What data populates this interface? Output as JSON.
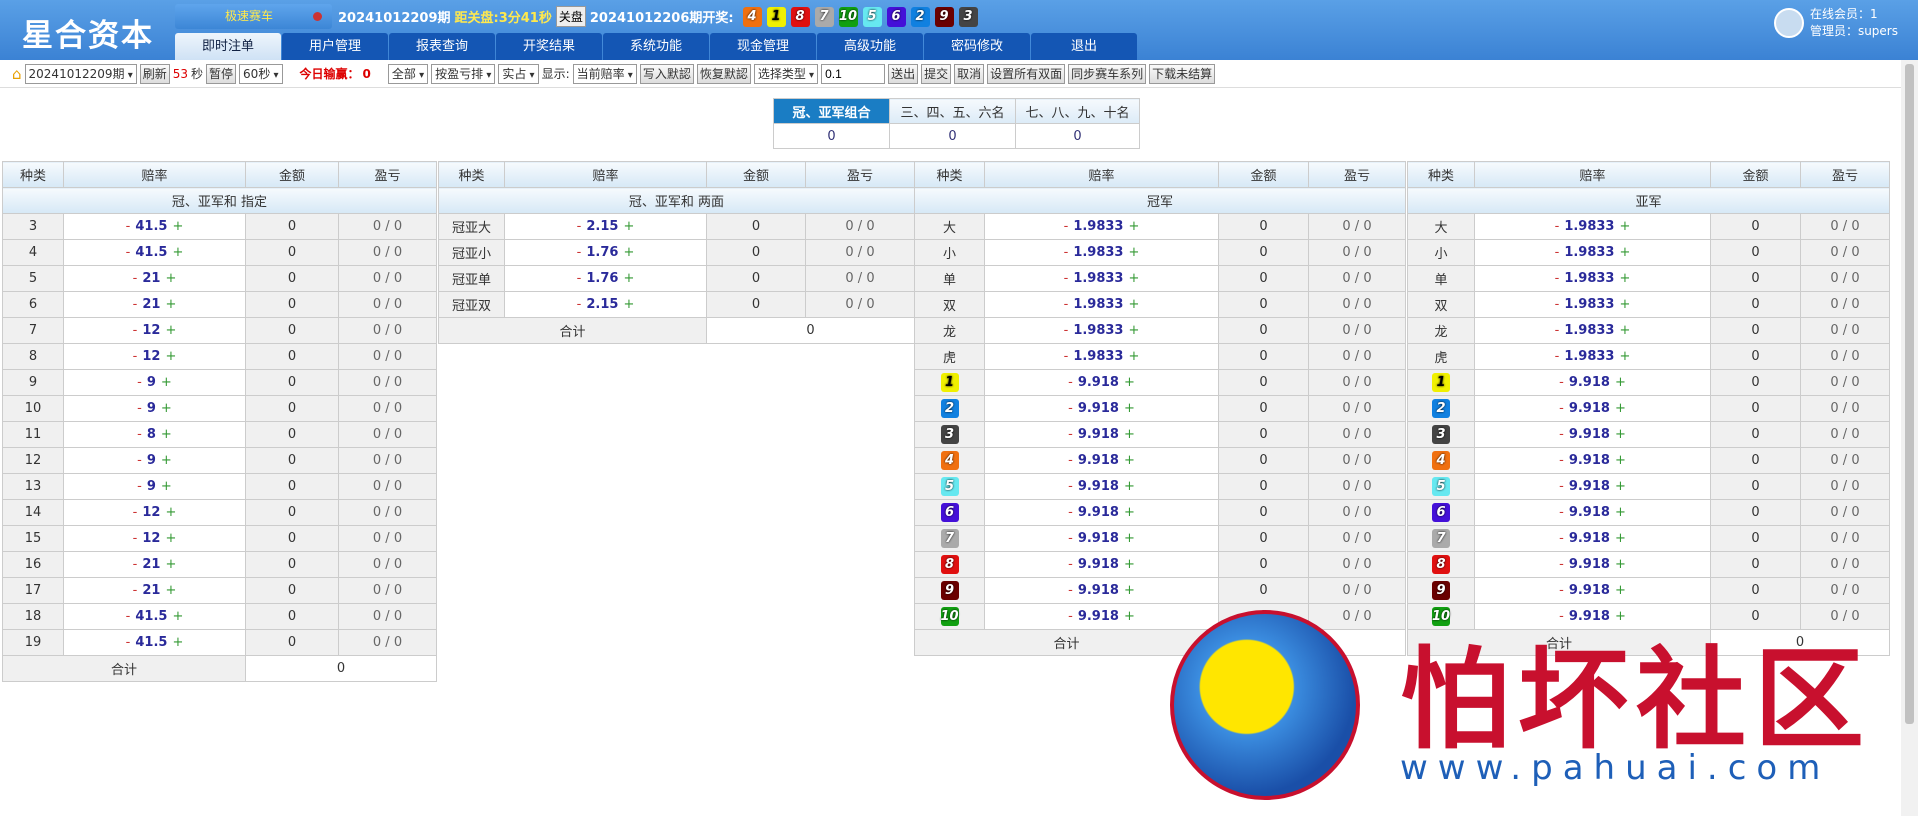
{
  "header": {
    "logo": "星合资本",
    "game": "极速赛车",
    "period": "20241012209期",
    "close_label": "距关盘:",
    "close_time": "3分41秒",
    "close_btn": "关盘",
    "last_period": "20241012206期开奖:",
    "balls": [
      {
        "n": "4",
        "c": "#f07010"
      },
      {
        "n": "1",
        "c": "#f0f000"
      },
      {
        "n": "8",
        "c": "#e01010"
      },
      {
        "n": "7",
        "c": "#aaaaaa"
      },
      {
        "n": "10",
        "c": "#11a011"
      },
      {
        "n": "5",
        "c": "#66e8f0"
      },
      {
        "n": "6",
        "c": "#4410d8"
      },
      {
        "n": "2",
        "c": "#1080e0"
      },
      {
        "n": "9",
        "c": "#6a0000"
      },
      {
        "n": "3",
        "c": "#444444"
      }
    ],
    "tabs": [
      "即时注单",
      "用户管理",
      "报表查询",
      "开奖结果",
      "系统功能",
      "现金管理",
      "高级功能",
      "密码修改",
      "退出"
    ],
    "online": "在线会员：1",
    "admin": "管理员：supers"
  },
  "toolbar": {
    "period": "20241012209期",
    "refresh": "刷新",
    "seconds": "53",
    "sec_unit": "秒",
    "pause": "暂停",
    "interval": "60秒",
    "today_label": "今日输赢：",
    "today_value": "0",
    "all": "全部",
    "sort": "按盈亏排",
    "real": "实占",
    "show_label": "显示:",
    "odds_mode": "当前赔率",
    "write_default": "写入默認",
    "restore_default": "恢复默認",
    "select_type": "选择类型",
    "value": "0.1",
    "send": "送出",
    "submit": "提交",
    "cancel": "取消",
    "set_all": "设置所有双面",
    "sync": "同步赛车系列",
    "download": "下载未结算"
  },
  "summary": {
    "headers": [
      "冠、亚军组合",
      "三、四、五、六名",
      "七、八、九、十名"
    ],
    "values": [
      "0",
      "0",
      "0"
    ]
  },
  "cols": [
    "种类",
    "赔率",
    "金额",
    "盈亏"
  ],
  "total_label": "合计",
  "tables": [
    {
      "title": "冠、亚军和 指定",
      "total": "0",
      "rows": [
        [
          "3",
          "41.5"
        ],
        [
          "4",
          "41.5"
        ],
        [
          "5",
          "21"
        ],
        [
          "6",
          "21"
        ],
        [
          "7",
          "12"
        ],
        [
          "8",
          "12"
        ],
        [
          "9",
          "9"
        ],
        [
          "10",
          "9"
        ],
        [
          "11",
          "8"
        ],
        [
          "12",
          "9"
        ],
        [
          "13",
          "9"
        ],
        [
          "14",
          "12"
        ],
        [
          "15",
          "12"
        ],
        [
          "16",
          "21"
        ],
        [
          "17",
          "21"
        ],
        [
          "18",
          "41.5"
        ],
        [
          "19",
          "41.5"
        ]
      ]
    },
    {
      "title": "冠、亚军和 两面",
      "total": "0",
      "rows": [
        [
          "冠亚大",
          "2.15"
        ],
        [
          "冠亚小",
          "1.76"
        ],
        [
          "冠亚单",
          "1.76"
        ],
        [
          "冠亚双",
          "2.15"
        ]
      ]
    },
    {
      "title": "冠军",
      "total": "0",
      "rows": [
        [
          "大",
          "1.9833"
        ],
        [
          "小",
          "1.9833"
        ],
        [
          "单",
          "1.9833"
        ],
        [
          "双",
          "1.9833"
        ],
        [
          "龙",
          "1.9833"
        ],
        [
          "虎",
          "1.9833"
        ],
        [
          "1",
          "9.918"
        ],
        [
          "2",
          "9.918"
        ],
        [
          "3",
          "9.918"
        ],
        [
          "4",
          "9.918"
        ],
        [
          "5",
          "9.918"
        ],
        [
          "6",
          "9.918"
        ],
        [
          "7",
          "9.918"
        ],
        [
          "8",
          "9.918"
        ],
        [
          "9",
          "9.918"
        ],
        [
          "10",
          "9.918"
        ]
      ]
    },
    {
      "title": "亚军",
      "total": "0",
      "rows": [
        [
          "大",
          "1.9833"
        ],
        [
          "小",
          "1.9833"
        ],
        [
          "单",
          "1.9833"
        ],
        [
          "双",
          "1.9833"
        ],
        [
          "龙",
          "1.9833"
        ],
        [
          "虎",
          "1.9833"
        ],
        [
          "1",
          "9.918"
        ],
        [
          "2",
          "9.918"
        ],
        [
          "3",
          "9.918"
        ],
        [
          "4",
          "9.918"
        ],
        [
          "5",
          "9.918"
        ],
        [
          "6",
          "9.918"
        ],
        [
          "7",
          "9.918"
        ],
        [
          "8",
          "9.918"
        ],
        [
          "9",
          "9.918"
        ],
        [
          "10",
          "9.918"
        ]
      ]
    }
  ],
  "row_amount": "0",
  "row_profit": "0 / 0",
  "minus": "-",
  "plus": "+",
  "ball_colors": {
    "1": "#f0f000",
    "2": "#1080e0",
    "3": "#444444",
    "4": "#f07010",
    "5": "#66e8f0",
    "6": "#4410d8",
    "7": "#aaaaaa",
    "8": "#e01010",
    "9": "#6a0000",
    "10": "#11a011"
  },
  "watermark": {
    "text": "怕坏社区",
    "url": "www.pahuai.com"
  }
}
